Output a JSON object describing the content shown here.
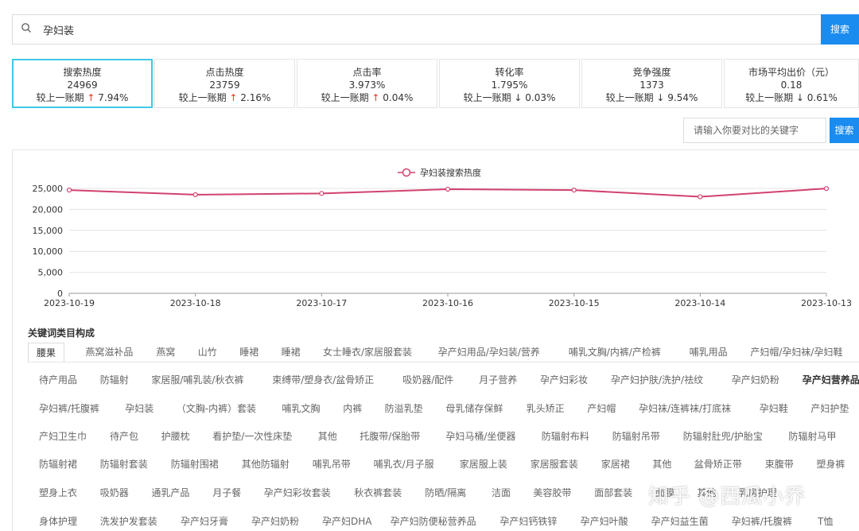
{
  "search": {
    "value": "孕妇装",
    "button_label": "搜索"
  },
  "cards": [
    {
      "title": "搜索热度",
      "value": "24969",
      "change_prefix": "较上一账期",
      "arrow": "↑",
      "change": "7.94%",
      "dir": "up",
      "active": true
    },
    {
      "title": "点击热度",
      "value": "23759",
      "change_prefix": "较上一账期",
      "arrow": "↑",
      "change": "2.16%",
      "dir": "up",
      "active": false
    },
    {
      "title": "点击率",
      "value": "3.973%",
      "change_prefix": "较上一账期",
      "arrow": "↑",
      "change": "0.04%",
      "dir": "up",
      "active": false
    },
    {
      "title": "转化率",
      "value": "1.795%",
      "change_prefix": "较上一账期",
      "arrow": "↓",
      "change": "0.03%",
      "dir": "down",
      "active": false
    },
    {
      "title": "竞争强度",
      "value": "1373",
      "change_prefix": "较上一账期",
      "arrow": "↓",
      "change": "9.54%",
      "dir": "down",
      "active": false
    },
    {
      "title": "市场平均出价（元）",
      "value": "0.18",
      "change_prefix": "较上一账期",
      "arrow": "↓",
      "change": "0.61%",
      "dir": "down",
      "active": false
    }
  ],
  "compare": {
    "placeholder": "请输入你要对比的关键字",
    "button_label": "搜索"
  },
  "chart_data": {
    "type": "line",
    "x": [
      "2023-10-19",
      "2023-10-18",
      "2023-10-17",
      "2023-10-16",
      "2023-10-15",
      "2023-10-14",
      "2023-10-13"
    ],
    "series": [
      {
        "name": "孕妇装搜索热度",
        "values": [
          24600,
          23500,
          23800,
          24800,
          24600,
          23000,
          24969
        ]
      }
    ],
    "yticks": [
      "0",
      "5,000",
      "10,000",
      "15,000",
      "20,000",
      "25,000"
    ],
    "ylim": [
      0,
      25000
    ],
    "grid": true,
    "legend": "top-center",
    "color": "#d2426e"
  },
  "categories": {
    "title": "关键词类目构成",
    "rows": [
      [
        "腰果",
        "燕窝滋补品",
        "燕窝",
        "山竹",
        "睡裙",
        "睡裙",
        "女士睡衣/家居服套装",
        "孕产妇用品/孕妇装/营养",
        "哺乳文胸/内裤/产检裤",
        "哺乳用品",
        "产妇帽/孕妇袜/孕妇鞋"
      ],
      [
        "待产用品",
        "防辐射",
        "家居服/哺乳装/秋衣裤",
        "束缚带/塑身衣/盆骨矫正",
        "吸奶器/配件",
        "月子营养",
        "孕产妇彩妆",
        "孕产妇护肤/洗护/祛纹",
        "孕产妇奶粉",
        "孕产妇营养品"
      ],
      [
        "孕妇裤/托腹裤",
        "孕妇装",
        "（文胸-内裤）套装",
        "哺乳文胸",
        "内裤",
        "防溢乳垫",
        "母乳储存保鲜",
        "乳头矫正",
        "产妇帽",
        "孕妇袜/连裤袜/打底袜",
        "孕妇鞋",
        "产妇护垫"
      ],
      [
        "产妇卫生巾",
        "待产包",
        "护腰枕",
        "看护垫/一次性床垫",
        "其他",
        "托腹带/保胎带",
        "孕妇马桶/坐便器",
        "防辐射布料",
        "防辐射吊带",
        "防辐射肚兜/护胎宝",
        "防辐射马甲"
      ],
      [
        "防辐射裙",
        "防辐射套装",
        "防辐射围裙",
        "其他防辐射",
        "哺乳吊带",
        "哺乳衣/月子服",
        "家居服上装",
        "家居服套装",
        "家居裙",
        "其他",
        "盆骨矫正带",
        "束腹带",
        "塑身裤"
      ],
      [
        "塑身上衣",
        "吸奶器",
        "通乳产品",
        "月子餐",
        "孕产妇彩妆套装",
        "秋衣裤套装",
        "防晒/隔离",
        "洁面",
        "美容胶带",
        "面部套装",
        "面膜",
        "其他",
        "乳房护理"
      ],
      [
        "身体护理",
        "洗发护发套装",
        "孕产妇牙膏",
        "孕产妇奶粉",
        "孕产妇DHA",
        "孕产妇防便秘营养品",
        "孕产妇钙铁锌",
        "孕产妇叶酸",
        "孕产妇益生菌",
        "孕妇裤/托腹裤",
        "T恤"
      ]
    ],
    "active_tag": "腰果",
    "bold_tag": "孕产妇营养品"
  },
  "watermark": "知乎 @西瓜小乔"
}
